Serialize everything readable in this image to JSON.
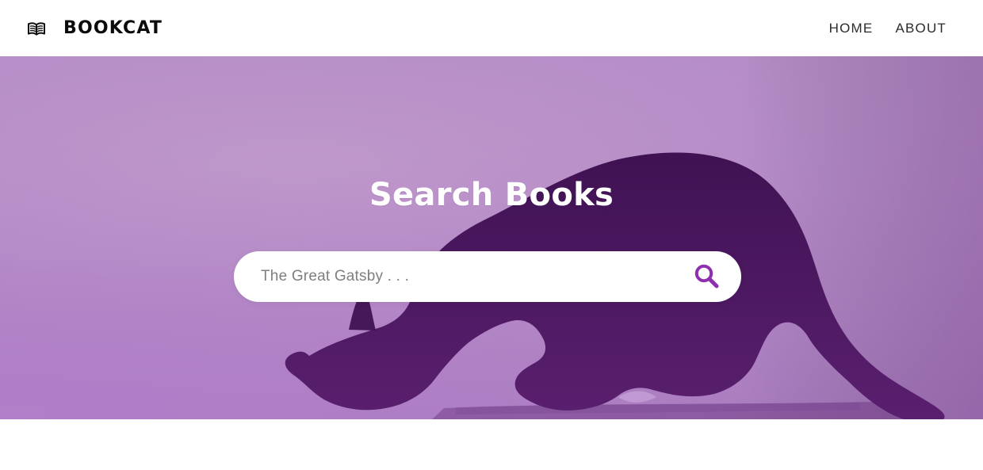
{
  "app": {
    "brand": "BOOKCAT",
    "brand_icon": "open-book-icon",
    "colors": {
      "accent": "#8e2fb0",
      "hero_base": "#b58bc7",
      "cat_silhouette": "#4a1a5b"
    }
  },
  "nav": {
    "items": [
      {
        "label": "HOME"
      },
      {
        "label": "ABOUT"
      }
    ]
  },
  "hero": {
    "title": "Search Books",
    "search": {
      "placeholder": "The Great Gatsby . . .",
      "value": "",
      "icon": "search-icon"
    }
  }
}
